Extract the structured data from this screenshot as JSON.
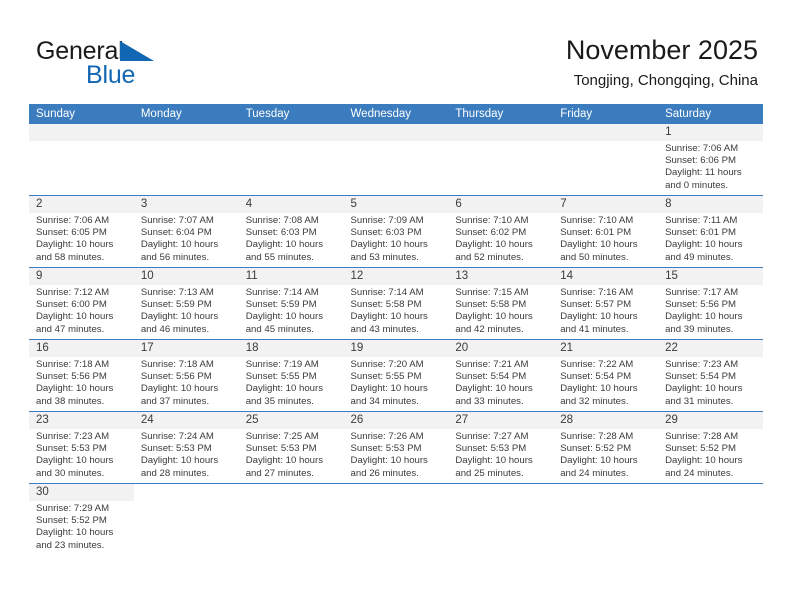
{
  "brand": {
    "name_part1": "General",
    "name_part2": "Blue",
    "flag_icon": "triangle-flag-icon",
    "color_primary": "#1267b2"
  },
  "header": {
    "title": "November 2025",
    "subtitle": "Tongjing, Chongqing, China"
  },
  "theme": {
    "header_blue": "#3b7cbe",
    "daynum_band": "#f2f2f2",
    "text": "#3b3b3b"
  },
  "weekdays": [
    "Sunday",
    "Monday",
    "Tuesday",
    "Wednesday",
    "Thursday",
    "Friday",
    "Saturday"
  ],
  "weeks": [
    [
      {
        "day": "",
        "lines": [],
        "empty": true
      },
      {
        "day": "",
        "lines": [],
        "empty": true
      },
      {
        "day": "",
        "lines": [],
        "empty": true
      },
      {
        "day": "",
        "lines": [],
        "empty": true
      },
      {
        "day": "",
        "lines": [],
        "empty": true
      },
      {
        "day": "",
        "lines": [],
        "empty": true
      },
      {
        "day": "1",
        "lines": [
          "Sunrise: 7:06 AM",
          "Sunset: 6:06 PM",
          "Daylight: 11 hours",
          "and 0 minutes."
        ]
      }
    ],
    [
      {
        "day": "2",
        "lines": [
          "Sunrise: 7:06 AM",
          "Sunset: 6:05 PM",
          "Daylight: 10 hours",
          "and 58 minutes."
        ]
      },
      {
        "day": "3",
        "lines": [
          "Sunrise: 7:07 AM",
          "Sunset: 6:04 PM",
          "Daylight: 10 hours",
          "and 56 minutes."
        ]
      },
      {
        "day": "4",
        "lines": [
          "Sunrise: 7:08 AM",
          "Sunset: 6:03 PM",
          "Daylight: 10 hours",
          "and 55 minutes."
        ]
      },
      {
        "day": "5",
        "lines": [
          "Sunrise: 7:09 AM",
          "Sunset: 6:03 PM",
          "Daylight: 10 hours",
          "and 53 minutes."
        ]
      },
      {
        "day": "6",
        "lines": [
          "Sunrise: 7:10 AM",
          "Sunset: 6:02 PM",
          "Daylight: 10 hours",
          "and 52 minutes."
        ]
      },
      {
        "day": "7",
        "lines": [
          "Sunrise: 7:10 AM",
          "Sunset: 6:01 PM",
          "Daylight: 10 hours",
          "and 50 minutes."
        ]
      },
      {
        "day": "8",
        "lines": [
          "Sunrise: 7:11 AM",
          "Sunset: 6:01 PM",
          "Daylight: 10 hours",
          "and 49 minutes."
        ]
      }
    ],
    [
      {
        "day": "9",
        "lines": [
          "Sunrise: 7:12 AM",
          "Sunset: 6:00 PM",
          "Daylight: 10 hours",
          "and 47 minutes."
        ]
      },
      {
        "day": "10",
        "lines": [
          "Sunrise: 7:13 AM",
          "Sunset: 5:59 PM",
          "Daylight: 10 hours",
          "and 46 minutes."
        ]
      },
      {
        "day": "11",
        "lines": [
          "Sunrise: 7:14 AM",
          "Sunset: 5:59 PM",
          "Daylight: 10 hours",
          "and 45 minutes."
        ]
      },
      {
        "day": "12",
        "lines": [
          "Sunrise: 7:14 AM",
          "Sunset: 5:58 PM",
          "Daylight: 10 hours",
          "and 43 minutes."
        ]
      },
      {
        "day": "13",
        "lines": [
          "Sunrise: 7:15 AM",
          "Sunset: 5:58 PM",
          "Daylight: 10 hours",
          "and 42 minutes."
        ]
      },
      {
        "day": "14",
        "lines": [
          "Sunrise: 7:16 AM",
          "Sunset: 5:57 PM",
          "Daylight: 10 hours",
          "and 41 minutes."
        ]
      },
      {
        "day": "15",
        "lines": [
          "Sunrise: 7:17 AM",
          "Sunset: 5:56 PM",
          "Daylight: 10 hours",
          "and 39 minutes."
        ]
      }
    ],
    [
      {
        "day": "16",
        "lines": [
          "Sunrise: 7:18 AM",
          "Sunset: 5:56 PM",
          "Daylight: 10 hours",
          "and 38 minutes."
        ]
      },
      {
        "day": "17",
        "lines": [
          "Sunrise: 7:18 AM",
          "Sunset: 5:56 PM",
          "Daylight: 10 hours",
          "and 37 minutes."
        ]
      },
      {
        "day": "18",
        "lines": [
          "Sunrise: 7:19 AM",
          "Sunset: 5:55 PM",
          "Daylight: 10 hours",
          "and 35 minutes."
        ]
      },
      {
        "day": "19",
        "lines": [
          "Sunrise: 7:20 AM",
          "Sunset: 5:55 PM",
          "Daylight: 10 hours",
          "and 34 minutes."
        ]
      },
      {
        "day": "20",
        "lines": [
          "Sunrise: 7:21 AM",
          "Sunset: 5:54 PM",
          "Daylight: 10 hours",
          "and 33 minutes."
        ]
      },
      {
        "day": "21",
        "lines": [
          "Sunrise: 7:22 AM",
          "Sunset: 5:54 PM",
          "Daylight: 10 hours",
          "and 32 minutes."
        ]
      },
      {
        "day": "22",
        "lines": [
          "Sunrise: 7:23 AM",
          "Sunset: 5:54 PM",
          "Daylight: 10 hours",
          "and 31 minutes."
        ]
      }
    ],
    [
      {
        "day": "23",
        "lines": [
          "Sunrise: 7:23 AM",
          "Sunset: 5:53 PM",
          "Daylight: 10 hours",
          "and 30 minutes."
        ]
      },
      {
        "day": "24",
        "lines": [
          "Sunrise: 7:24 AM",
          "Sunset: 5:53 PM",
          "Daylight: 10 hours",
          "and 28 minutes."
        ]
      },
      {
        "day": "25",
        "lines": [
          "Sunrise: 7:25 AM",
          "Sunset: 5:53 PM",
          "Daylight: 10 hours",
          "and 27 minutes."
        ]
      },
      {
        "day": "26",
        "lines": [
          "Sunrise: 7:26 AM",
          "Sunset: 5:53 PM",
          "Daylight: 10 hours",
          "and 26 minutes."
        ]
      },
      {
        "day": "27",
        "lines": [
          "Sunrise: 7:27 AM",
          "Sunset: 5:53 PM",
          "Daylight: 10 hours",
          "and 25 minutes."
        ]
      },
      {
        "day": "28",
        "lines": [
          "Sunrise: 7:28 AM",
          "Sunset: 5:52 PM",
          "Daylight: 10 hours",
          "and 24 minutes."
        ]
      },
      {
        "day": "29",
        "lines": [
          "Sunrise: 7:28 AM",
          "Sunset: 5:52 PM",
          "Daylight: 10 hours",
          "and 24 minutes."
        ]
      }
    ],
    [
      {
        "day": "30",
        "lines": [
          "Sunrise: 7:29 AM",
          "Sunset: 5:52 PM",
          "Daylight: 10 hours",
          "and 23 minutes."
        ]
      },
      {
        "day": "",
        "lines": [],
        "blank": true
      },
      {
        "day": "",
        "lines": [],
        "blank": true
      },
      {
        "day": "",
        "lines": [],
        "blank": true
      },
      {
        "day": "",
        "lines": [],
        "blank": true
      },
      {
        "day": "",
        "lines": [],
        "blank": true
      },
      {
        "day": "",
        "lines": [],
        "blank": true
      }
    ]
  ]
}
